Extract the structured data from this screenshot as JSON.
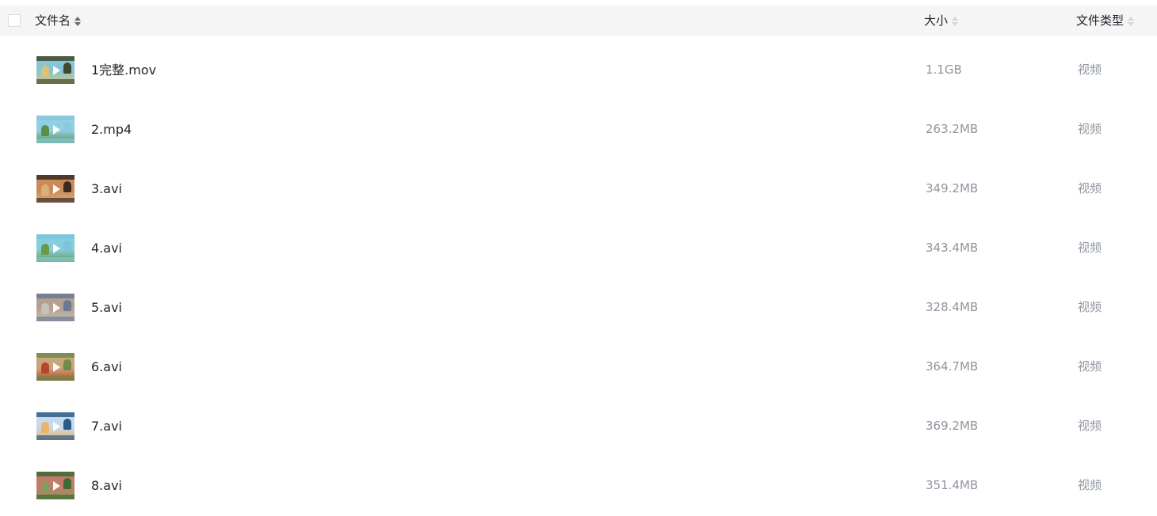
{
  "header": {
    "name_label": "文件名",
    "size_label": "大小",
    "type_label": "文件类型"
  },
  "files": [
    {
      "name": "1完整.mov",
      "size": "1.1GB",
      "type": "视频",
      "thumb_colors": [
        "#3f4a2e",
        "#86c4d8",
        "#d9c37a"
      ]
    },
    {
      "name": "2.mp4",
      "size": "263.2MB",
      "type": "视频",
      "thumb_colors": [
        "#89c9dc",
        "#8fd0e2",
        "#5a8f4a"
      ]
    },
    {
      "name": "3.avi",
      "size": "349.2MB",
      "type": "视频",
      "thumb_colors": [
        "#3a2a22",
        "#c98a5a",
        "#d8b07a"
      ]
    },
    {
      "name": "4.avi",
      "size": "343.4MB",
      "type": "视频",
      "thumb_colors": [
        "#7cc4da",
        "#86cde0",
        "#6a9a48"
      ]
    },
    {
      "name": "5.avi",
      "size": "328.4MB",
      "type": "视频",
      "thumb_colors": [
        "#6b7a92",
        "#b4a091",
        "#c7c2b6"
      ]
    },
    {
      "name": "6.avi",
      "size": "364.7MB",
      "type": "视频",
      "thumb_colors": [
        "#6f8a4a",
        "#c9a57a",
        "#b8452a"
      ]
    },
    {
      "name": "7.avi",
      "size": "369.2MB",
      "type": "视频",
      "thumb_colors": [
        "#2a5a8a",
        "#c7d9ea",
        "#e8b36a"
      ]
    },
    {
      "name": "8.avi",
      "size": "351.4MB",
      "type": "视频",
      "thumb_colors": [
        "#3f6a32",
        "#c47a6a",
        "#8a9a5a"
      ]
    }
  ]
}
